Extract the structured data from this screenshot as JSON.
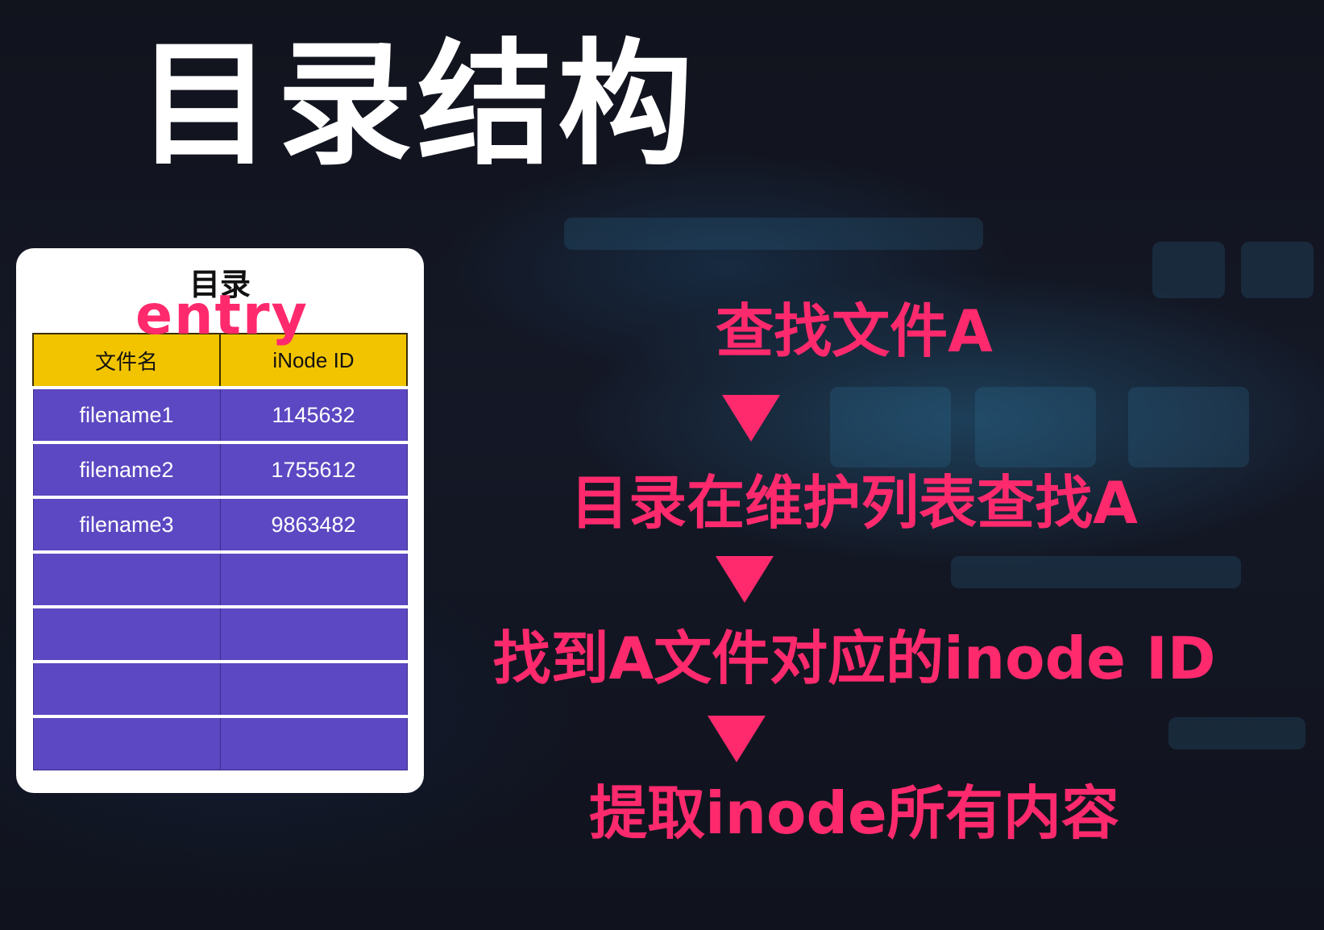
{
  "title": "目录结构",
  "directory_card": {
    "title": "目录",
    "entry_label": "entry",
    "headers": [
      "文件名",
      "iNode ID"
    ],
    "rows": [
      [
        "filename1",
        "1145632"
      ],
      [
        "filename2",
        "1755612"
      ],
      [
        "filename3",
        "9863482"
      ],
      [
        "",
        ""
      ],
      [
        "",
        ""
      ],
      [
        "",
        ""
      ],
      [
        "",
        ""
      ]
    ]
  },
  "steps": [
    "查找文件A",
    "目录在维护列表查找A",
    "找到A文件对应的inode ID",
    "提取inode所有内容"
  ],
  "colors": {
    "accent_pink": "#ff2a6d",
    "header_yellow": "#f2c400",
    "row_purple": "#5b48c2",
    "background": "#0f111c"
  }
}
